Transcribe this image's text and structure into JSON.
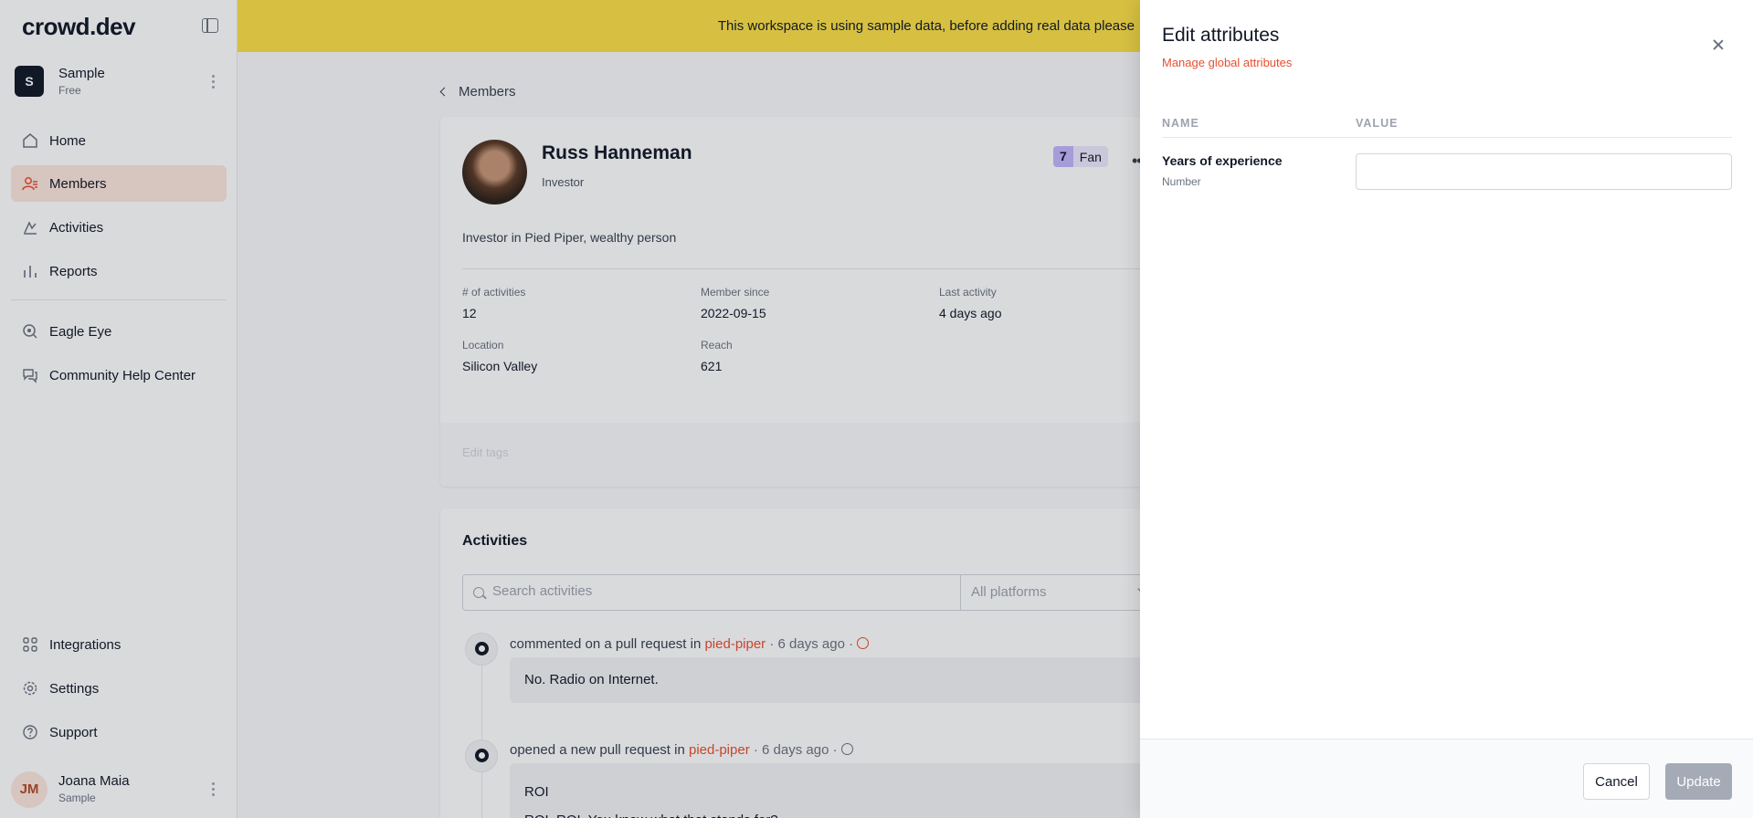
{
  "app": {
    "logo": "crowd.dev"
  },
  "workspace": {
    "avatar_letter": "S",
    "name": "Sample",
    "plan": "Free"
  },
  "nav": {
    "items": [
      {
        "label": "Home",
        "icon": "home-icon"
      },
      {
        "label": "Members",
        "icon": "members-icon",
        "active": true
      },
      {
        "label": "Activities",
        "icon": "activities-icon"
      },
      {
        "label": "Reports",
        "icon": "reports-icon"
      }
    ],
    "secondary": [
      {
        "label": "Eagle Eye",
        "icon": "eagle-eye-icon"
      },
      {
        "label": "Community Help Center",
        "icon": "help-center-icon"
      }
    ],
    "bottom": [
      {
        "label": "Integrations",
        "icon": "integrations-icon"
      },
      {
        "label": "Settings",
        "icon": "settings-icon"
      },
      {
        "label": "Support",
        "icon": "support-icon"
      }
    ]
  },
  "user": {
    "initials": "JM",
    "name": "Joana Maia",
    "workspace": "Sample"
  },
  "banner": {
    "text": "This workspace is using sample data, before adding real data please"
  },
  "breadcrumb": {
    "label": "Members"
  },
  "member": {
    "name": "Russ Hanneman",
    "role": "Investor",
    "engagement_level": "7",
    "engagement_label": "Fan",
    "bio": "Investor in Pied Piper, wealthy person",
    "stats": [
      {
        "label": "# of activities",
        "value": "12"
      },
      {
        "label": "Member since",
        "value": "2022-09-15"
      },
      {
        "label": "Last activity",
        "value": "4 days ago"
      },
      {
        "label": "Location",
        "value": "Silicon Valley"
      },
      {
        "label": "Reach",
        "value": "621"
      }
    ],
    "edit_tags_label": "Edit tags"
  },
  "activities": {
    "title": "Activities",
    "search_placeholder": "Search activities",
    "platform_placeholder": "All platforms",
    "items": [
      {
        "text": "commented on a pull request in ",
        "repo": "pied-piper",
        "meta": " · 6 days ago · ",
        "sentiment": "negative",
        "sentiment_color": "#e94f2e",
        "body": [
          "No. Radio on Internet."
        ]
      },
      {
        "text": "opened a new pull request in ",
        "repo": "pied-piper",
        "meta": " · 6 days ago · ",
        "sentiment": "neutral",
        "sentiment_color": "#6b7280",
        "body": [
          "ROI",
          "ROI, ROI. You know what that stands for?"
        ]
      }
    ]
  },
  "drawer": {
    "title": "Edit attributes",
    "manage_link": "Manage global attributes",
    "col_name": "NAME",
    "col_value": "VALUE",
    "attribute": {
      "name": "Years of experience",
      "type": "Number",
      "value": ""
    },
    "cancel_label": "Cancel",
    "update_label": "Update"
  },
  "colors": {
    "accent": "#e94f2e",
    "banner": "#fde047",
    "active_nav": "#fde6dd",
    "badge": "#c4b5fd"
  }
}
